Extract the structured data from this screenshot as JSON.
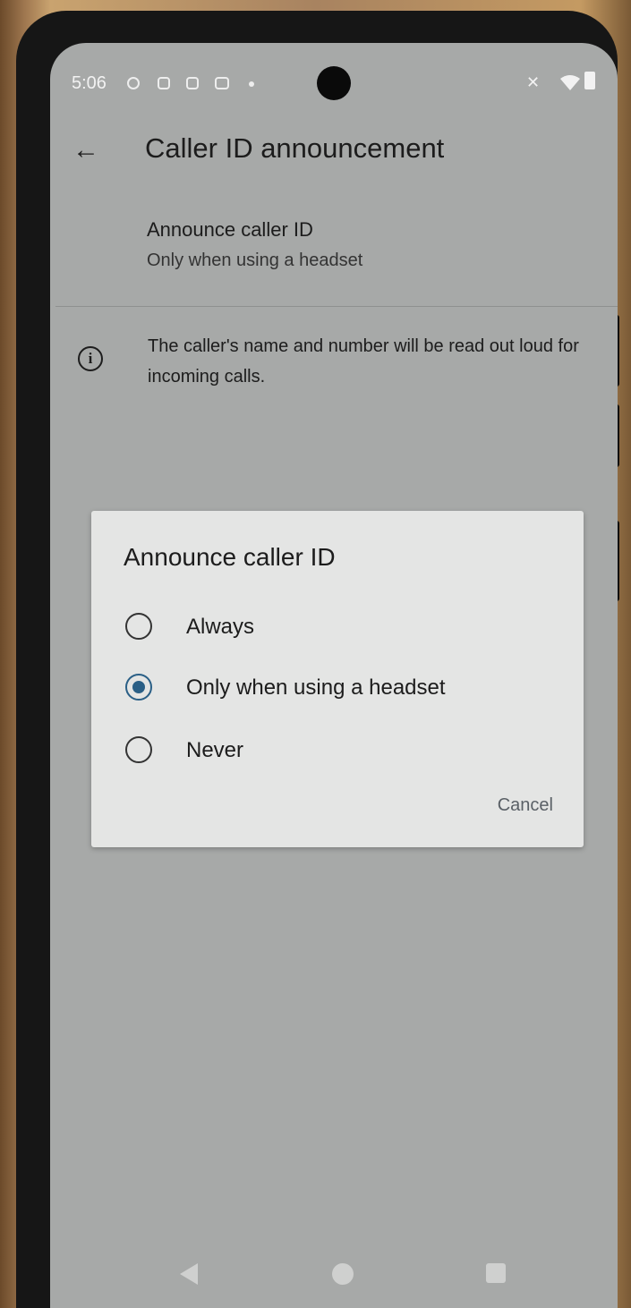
{
  "status_bar": {
    "time": "5:06",
    "left_icons": [
      "notification-icon",
      "sim-icon",
      "bag-icon",
      "message-icon"
    ],
    "right_icons": [
      "vibrate-off-icon",
      "wifi-icon",
      "battery-icon"
    ]
  },
  "app_bar": {
    "back_icon": "arrow-back-icon",
    "title": "Caller ID announcement"
  },
  "preference": {
    "title": "Announce caller ID",
    "summary": "Only when using a headset"
  },
  "info": {
    "icon": "info-icon",
    "text": "The caller's name and number will be read out loud for incoming calls."
  },
  "dialog": {
    "title": "Announce caller ID",
    "options": [
      {
        "label": "Always",
        "selected": false
      },
      {
        "label": "Only when using a headset",
        "selected": true
      },
      {
        "label": "Never",
        "selected": false
      }
    ],
    "cancel_label": "Cancel"
  },
  "colors": {
    "accent": "#2a5f86",
    "screen_dim": "#a7a9a8",
    "dialog_bg": "#e4e5e4"
  }
}
